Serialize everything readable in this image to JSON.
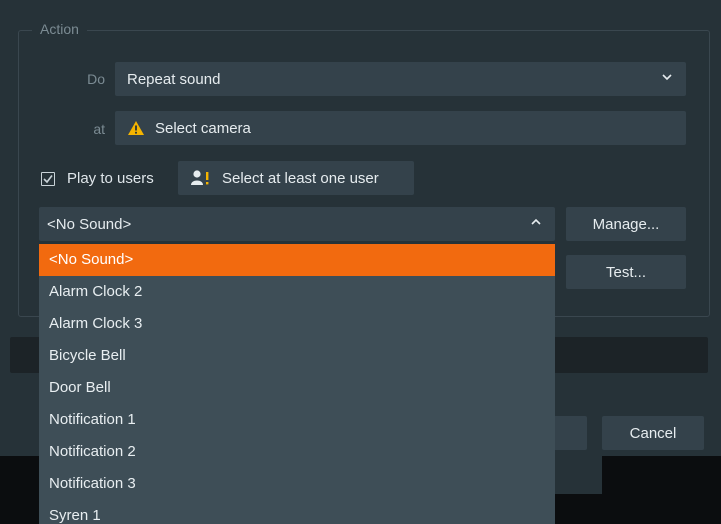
{
  "action": {
    "group_title": "Action",
    "do_label": "Do",
    "do_value": "Repeat sound",
    "at_label": "at",
    "at_value": "Select camera",
    "play_to_users_label": "Play to users",
    "select_user_label": "Select at least one user",
    "sound_value": "<No Sound>",
    "manage_label": "Manage...",
    "test_label": "Test..."
  },
  "footer": {
    "cancel_label": "Cancel"
  },
  "dropdown": {
    "items": [
      "<No Sound>",
      "Alarm Clock 2",
      "Alarm Clock 3",
      "Bicycle Bell",
      "Door Bell",
      "Notification 1",
      "Notification 2",
      "Notification 3",
      "Syren 1"
    ],
    "selected_index": 0
  },
  "colors": {
    "accent": "#f26a0f",
    "warning": "#f5b400",
    "background": "#263238",
    "field": "#34424b"
  }
}
